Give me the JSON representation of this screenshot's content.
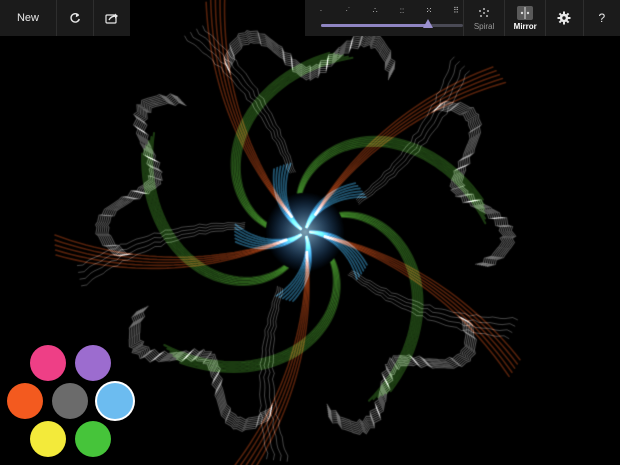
{
  "toolbar": {
    "new_label": "New",
    "refresh_icon": "refresh-icon",
    "share_icon": "share-icon",
    "symmetry_levels": [
      "1",
      "2",
      "3",
      "4",
      "5",
      "6"
    ],
    "symmetry_value": 0.75,
    "modes": [
      {
        "label": "Spiral",
        "icon": "spiral-icon",
        "active": false
      },
      {
        "label": "Mirror",
        "icon": "mirror-icon",
        "active": true
      }
    ],
    "settings_icon": "gear-icon",
    "help_label": "?"
  },
  "palette": {
    "colors": [
      {
        "name": "pink",
        "hex": "#ee3f86"
      },
      {
        "name": "purple",
        "hex": "#9c6ccf"
      },
      {
        "name": "orange",
        "hex": "#f35a1f"
      },
      {
        "name": "gray",
        "hex": "#6b6b6b"
      },
      {
        "name": "blue",
        "hex": "#6cbcf0",
        "selected": true
      },
      {
        "name": "yellow",
        "hex": "#f3ea3a"
      },
      {
        "name": "green",
        "hex": "#46c43a"
      }
    ]
  },
  "stroke_colors": {
    "white": "#e6e6e6",
    "green": "#5fd13c",
    "orange": "#f05a1c",
    "blue": "#44b6f2"
  }
}
